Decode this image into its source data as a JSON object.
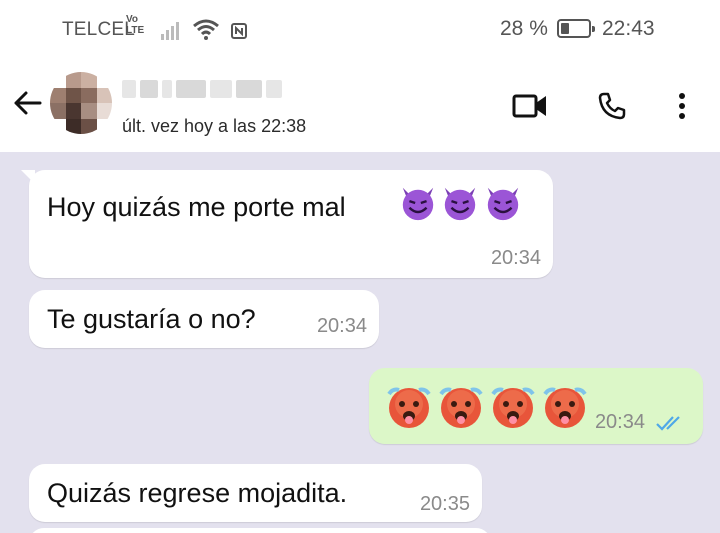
{
  "status_bar": {
    "carrier": "TELCEL",
    "volte_top": "Vo",
    "volte_bottom": "LTE",
    "battery_percent": "28 %",
    "battery_level": 0.28,
    "time": "22:43"
  },
  "header": {
    "last_seen": "últ. vez hoy a las 22:38"
  },
  "messages": [
    {
      "direction": "in",
      "text": "Hoy quizás me porte mal",
      "emoji": "smiling-devil-face x3",
      "time": "20:34"
    },
    {
      "direction": "in",
      "text": "Te gustaría o no?",
      "time": "20:34"
    },
    {
      "direction": "out",
      "emoji": "hot-face x4",
      "time": "20:34",
      "status": "read-double-check"
    },
    {
      "direction": "in",
      "text": "Quizás regrese mojadita.",
      "time": "20:35"
    }
  ],
  "colors": {
    "chat_background": "#e3e1ee",
    "incoming_bubble": "#ffffff",
    "outgoing_bubble": "#dcf7c8",
    "read_check": "#4fa8e8"
  },
  "icons": [
    "back-arrow-icon",
    "video-call-icon",
    "phone-call-icon",
    "more-options-icon",
    "signal-icon",
    "wifi-icon",
    "nfc-icon",
    "battery-icon",
    "double-check-icon"
  ]
}
